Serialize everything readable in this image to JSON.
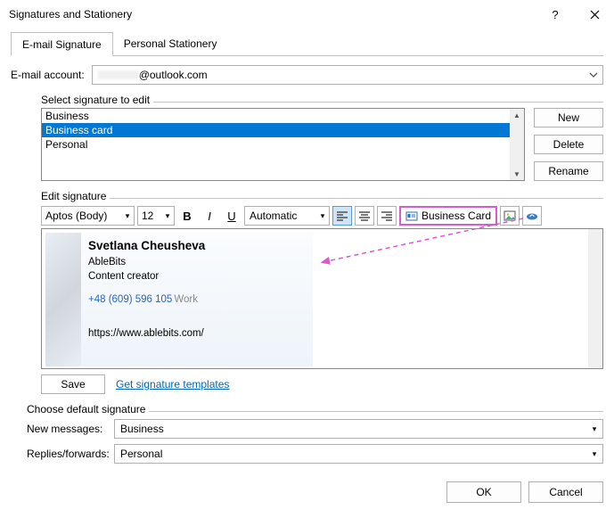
{
  "title": "Signatures and Stationery",
  "tabs": {
    "email_sig": "E-mail Signature",
    "personal": "Personal Stationery"
  },
  "account_label": "E-mail account:",
  "account_value": "@outlook.com",
  "select_sig_label": "Select signature to edit",
  "signatures": {
    "items": [
      "Business",
      "Business card",
      "Personal"
    ],
    "selected_index": 1
  },
  "buttons": {
    "new": "New",
    "delete": "Delete",
    "rename": "Rename",
    "save": "Save",
    "ok": "OK",
    "cancel": "Cancel"
  },
  "edit_label": "Edit signature",
  "toolbar": {
    "font": "Aptos (Body)",
    "size": "12",
    "color_mode": "Automatic",
    "bizcard": "Business Card"
  },
  "card": {
    "name": "Svetlana Cheusheva",
    "company": "AbleBits",
    "role": "Content creator",
    "phone": "+48 (609) 596 105",
    "phone_kind": "Work",
    "url": "https://www.ablebits.com/"
  },
  "get_templates": "Get signature templates",
  "choose_default": "Choose default signature",
  "new_messages_label": "New messages:",
  "new_messages_value": "Business",
  "replies_label": "Replies/forwards:",
  "replies_value": "Personal"
}
